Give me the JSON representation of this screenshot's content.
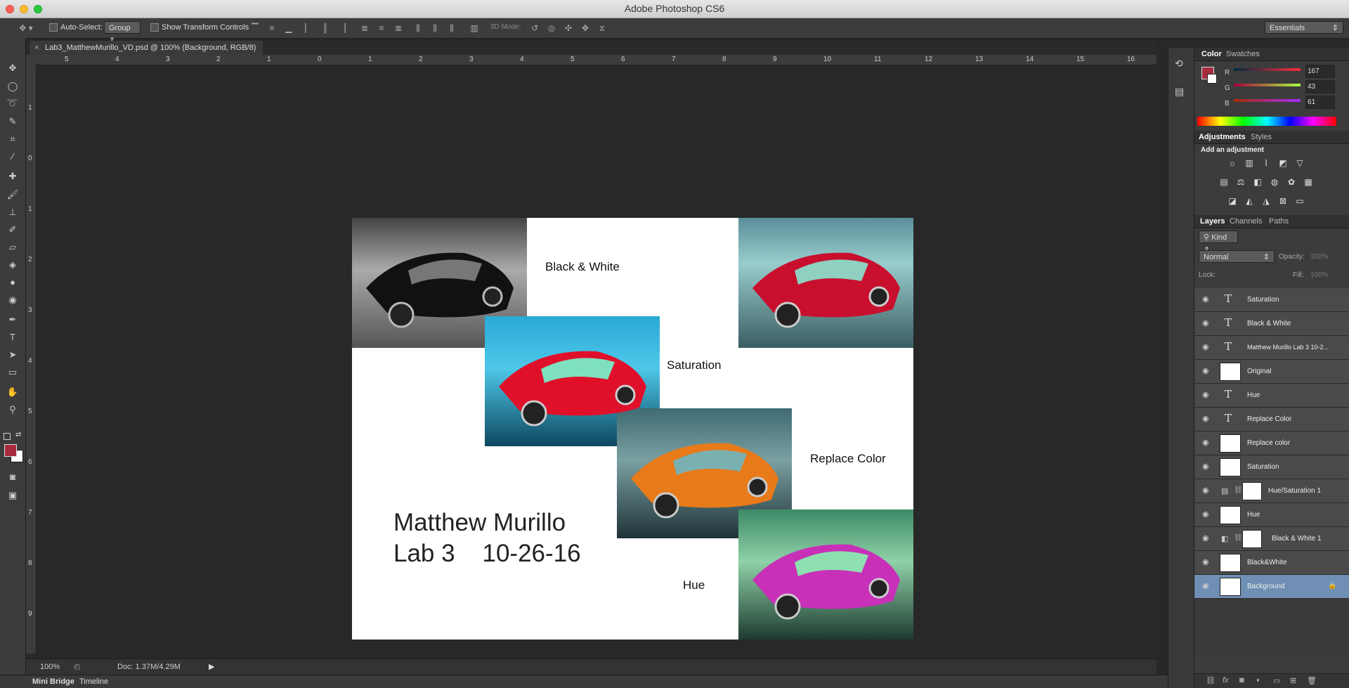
{
  "app": {
    "title": "Adobe Photoshop CS6",
    "workspace_preset": "Essentials"
  },
  "options_bar": {
    "auto_select_label": "Auto-Select:",
    "auto_select_value": "Group",
    "show_transform_label": "Show Transform Controls",
    "mode_3d_label": "3D Mode:"
  },
  "document": {
    "tab_title": "Lab3_MatthewMurillo_VD.psd @ 100% (Background, RGB/8)",
    "zoom": "100%",
    "doc_size": "Doc: 1.37M/4.29M"
  },
  "rulers": {
    "h_labels": [
      "5",
      "4",
      "3",
      "2",
      "1",
      "0",
      "1",
      "2",
      "3",
      "4",
      "5",
      "6",
      "7",
      "8",
      "9",
      "10",
      "11",
      "12",
      "13",
      "14",
      "15",
      "16"
    ],
    "v_labels": [
      "1",
      "0",
      "1",
      "2",
      "3",
      "4",
      "5",
      "6",
      "7",
      "8",
      "9"
    ]
  },
  "canvas": {
    "label_bw": "Black & White",
    "label_saturation": "Saturation",
    "label_replace": "Replace Color",
    "label_hue": "Hue",
    "name_line1": "Matthew Murillo",
    "name_line2": "Lab 3    10-26-16"
  },
  "bottom_tabs": {
    "mini_bridge": "Mini Bridge",
    "timeline": "Timeline"
  },
  "color_panel": {
    "tab_color": "Color",
    "tab_swatches": "Swatches",
    "r_label": "R",
    "g_label": "G",
    "b_label": "B",
    "r_value": "167",
    "g_value": "43",
    "b_value": "61",
    "foreground": "#a72b3d"
  },
  "adjustments_panel": {
    "tab_adjustments": "Adjustments",
    "tab_styles": "Styles",
    "heading": "Add an adjustment"
  },
  "layers_panel": {
    "tab_layers": "Layers",
    "tab_channels": "Channels",
    "tab_paths": "Paths",
    "filter_kind": "Kind",
    "blend_mode": "Normal",
    "opacity_label": "Opacity:",
    "opacity_value": "100%",
    "lock_label": "Lock:",
    "fill_label": "Fill:",
    "fill_value": "100%",
    "layers": [
      {
        "name": "Saturation",
        "kind": "text"
      },
      {
        "name": "Black & White",
        "kind": "text"
      },
      {
        "name": "Matthew Murillo Lab 3    10-2...",
        "kind": "text"
      },
      {
        "name": "Original",
        "kind": "pixel"
      },
      {
        "name": "Hue",
        "kind": "text"
      },
      {
        "name": "Replace Color",
        "kind": "text"
      },
      {
        "name": "Replace color",
        "kind": "pixel"
      },
      {
        "name": "Saturation",
        "kind": "pixel"
      },
      {
        "name": "Hue/Saturation 1",
        "kind": "adjustment"
      },
      {
        "name": "Hue",
        "kind": "pixel"
      },
      {
        "name": "Black & White 1",
        "kind": "adjustment"
      },
      {
        "name": "Black&White",
        "kind": "pixel"
      },
      {
        "name": "Background",
        "kind": "background"
      }
    ]
  }
}
